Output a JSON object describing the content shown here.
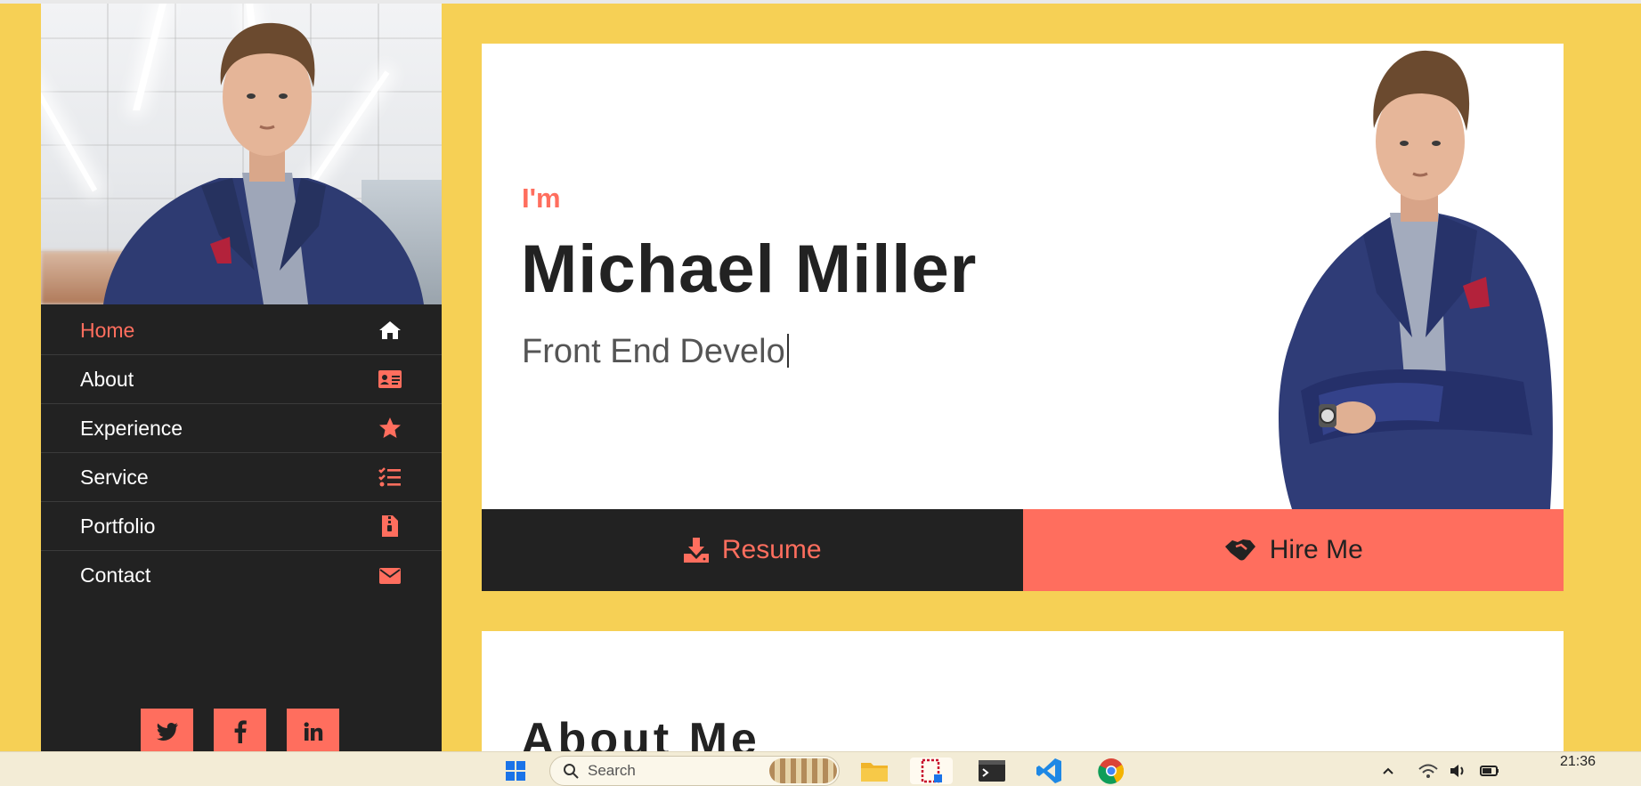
{
  "nav": {
    "items": [
      {
        "label": "Home",
        "icon": "home-icon",
        "active": true
      },
      {
        "label": "About",
        "icon": "id-card-icon",
        "active": false
      },
      {
        "label": "Experience",
        "icon": "star-icon",
        "active": false
      },
      {
        "label": "Service",
        "icon": "tasks-icon",
        "active": false
      },
      {
        "label": "Portfolio",
        "icon": "file-zip-icon",
        "active": false
      },
      {
        "label": "Contact",
        "icon": "envelope-icon",
        "active": false
      }
    ]
  },
  "social": [
    "twitter-icon",
    "facebook-icon",
    "linkedin-icon"
  ],
  "hero": {
    "intro": "I'm",
    "name": "Michael Miller",
    "role": "Front End Develo"
  },
  "buttons": {
    "resume": "Resume",
    "hire": "Hire Me"
  },
  "about": {
    "heading": "About Me"
  },
  "taskbar": {
    "search_placeholder": "Search",
    "time": "21:36"
  },
  "colors": {
    "background": "#f6d055",
    "accent": "#ff6e5e",
    "dark": "#222222",
    "card": "#ffffff"
  }
}
